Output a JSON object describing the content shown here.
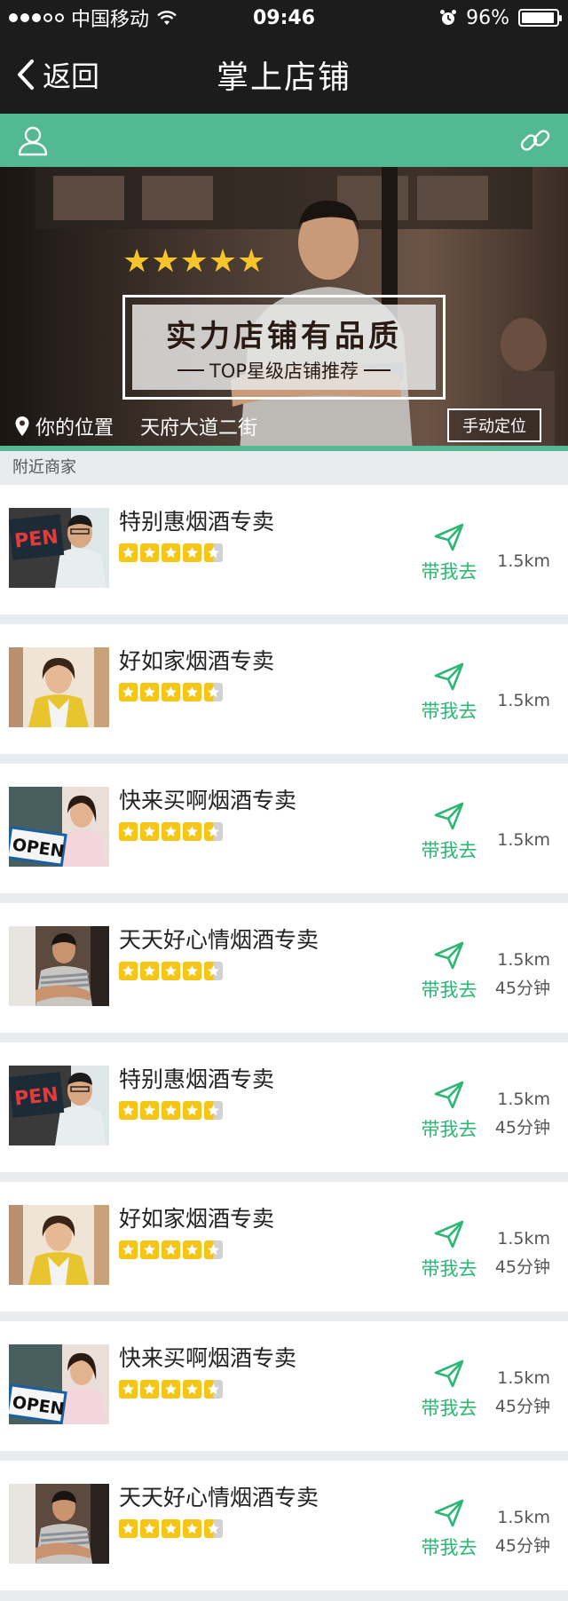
{
  "status_bar": {
    "carrier": "中国移动",
    "time": "09:46",
    "battery": "96%",
    "battery_level": 0.96
  },
  "nav": {
    "back_label": "返回",
    "title": "掌上店铺"
  },
  "toolbar": {
    "user_icon": "user-icon",
    "link_icon": "link-icon",
    "color": "#52b992"
  },
  "hero": {
    "stars": "★★★★★",
    "headline": "实力店铺有品质",
    "subheadline": "TOP星级店铺推荐",
    "location_label": "你的位置",
    "street": "天府大道二街",
    "manual_locate": "手动定位"
  },
  "section": {
    "nearby": "附近商家"
  },
  "shops": [
    {
      "name": "特别惠烟酒专卖",
      "go": "带我去",
      "distance": "1.5km",
      "time": "",
      "rating": 4.5,
      "thumb": "open-sign-man"
    },
    {
      "name": "好如家烟酒专卖",
      "go": "带我去",
      "distance": "1.5km",
      "time": "",
      "rating": 4.5,
      "thumb": "woman-shop"
    },
    {
      "name": "快来买啊烟酒专卖",
      "go": "带我去",
      "distance": "1.5km",
      "time": "",
      "rating": 4.5,
      "thumb": "open-sign-woman"
    },
    {
      "name": "天天好心情烟酒专卖",
      "go": "带我去",
      "distance": "1.5km",
      "time": "45分钟",
      "rating": 4.5,
      "thumb": "man-arms"
    },
    {
      "name": "特别惠烟酒专卖",
      "go": "带我去",
      "distance": "1.5km",
      "time": "45分钟",
      "rating": 4.5,
      "thumb": "open-sign-man"
    },
    {
      "name": "好如家烟酒专卖",
      "go": "带我去",
      "distance": "1.5km",
      "time": "45分钟",
      "rating": 4.5,
      "thumb": "woman-shop"
    },
    {
      "name": "快来买啊烟酒专卖",
      "go": "带我去",
      "distance": "1.5km",
      "time": "45分钟",
      "rating": 4.5,
      "thumb": "open-sign-woman"
    },
    {
      "name": "天天好心情烟酒专卖",
      "go": "带我去",
      "distance": "1.5km",
      "time": "45分钟",
      "rating": 4.5,
      "thumb": "man-arms"
    }
  ],
  "colors": {
    "accent_green": "#2cb774",
    "star_yellow": "#f5c518",
    "nav_bg": "#1c1c1c"
  }
}
